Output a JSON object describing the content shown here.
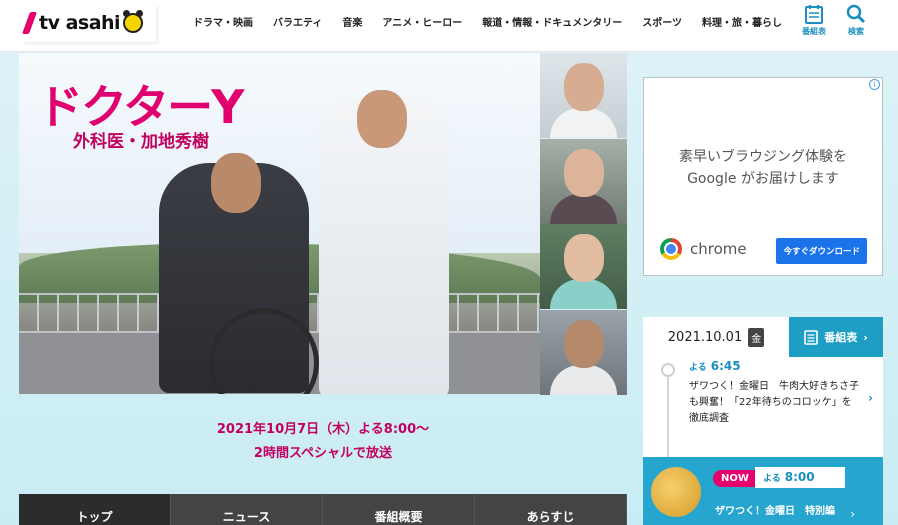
{
  "header": {
    "logo_text": "tv asahi",
    "nav": [
      "ドラマ・映画",
      "バラエティ",
      "音楽",
      "アニメ・ヒーロー",
      "報道・情報・ドキュメンタリー",
      "スポーツ",
      "料理・旅・暮らし"
    ],
    "schedule_label": "番組表",
    "search_label": "検索",
    "accent": "#e6006e",
    "link_color": "#1a8fbf"
  },
  "hero": {
    "title": "ドクターY",
    "subtitle": "外科医・加地秀樹"
  },
  "broadcast": {
    "line1": "2021年10月7日（木）よる8:00〜",
    "line2": "2時間スペシャルで放送"
  },
  "tabs": [
    "トップ",
    "ニュース",
    "番組概要",
    "あらすじ"
  ],
  "ad": {
    "info_icon": "i",
    "line1": "素早いブラウジング体験を",
    "line2": "Google がお届けします",
    "brand": "chrome",
    "button": "今すぐダウンロード"
  },
  "schedule": {
    "date": "2021.10.01",
    "day": "金",
    "button_label": "番組表",
    "chevron": "›",
    "program": {
      "time_prefix": "よる",
      "time": "6:45",
      "title": "ザワつく！金曜日　牛肉大好きちさ子も興奮！「22年待ちのコロッケ」を徹底調査"
    },
    "now": {
      "badge": "NOW",
      "time_prefix": "よる",
      "time": "8:00",
      "title": "ザワつく！金曜日　特別編"
    }
  }
}
